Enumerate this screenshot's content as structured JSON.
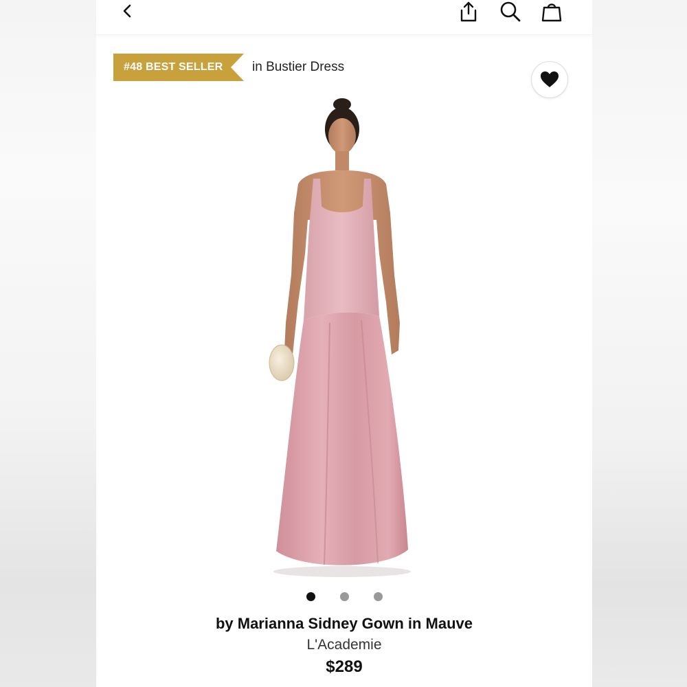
{
  "header": {
    "back_icon": "chevron-left-icon",
    "share_icon": "share-icon",
    "search_icon": "search-icon",
    "bag_icon": "shopping-bag-icon"
  },
  "badge": {
    "label": "#48 BEST SELLER",
    "category": "in Bustier Dress",
    "color": "#c9a13c"
  },
  "favorite": {
    "icon": "heart-icon",
    "state": "favorited"
  },
  "gallery": {
    "image_count": 3,
    "active_index": 0
  },
  "product": {
    "title": "by Marianna Sidney Gown in Mauve",
    "brand": "L'Academie",
    "price": "$289",
    "dress_color": "#d9a2a9"
  }
}
